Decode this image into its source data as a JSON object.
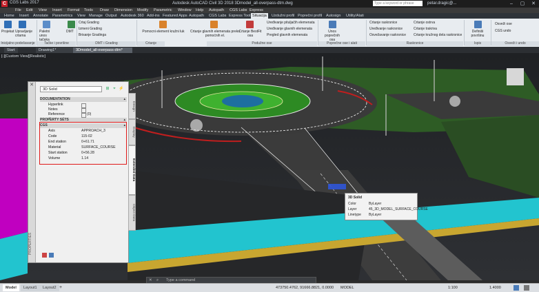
{
  "app": {
    "badge": "C",
    "quick_access": "CGS Labs 2017",
    "window_title": "Autodesk AutoCAD Civil 3D 2018   3Dmodel_all-overpass-dtm.dwg",
    "search_placeholder": "Type a keyword or phrase",
    "user": "petar.dragic@...",
    "min": "–",
    "max": "▢",
    "close": "✕"
  },
  "menu": [
    "File",
    "Edit",
    "View",
    "Insert",
    "Format",
    "Tools",
    "Draw",
    "Dimension",
    "Modify",
    "Parametric",
    "Window",
    "Help",
    "Autopath",
    "CGS Labs",
    "Express"
  ],
  "ribbon_tabs": [
    {
      "label": "Home"
    },
    {
      "label": "Insert"
    },
    {
      "label": "Annotate"
    },
    {
      "label": "Parametrics"
    },
    {
      "label": "View"
    },
    {
      "label": "Manage"
    },
    {
      "label": "Output"
    },
    {
      "label": "Autodesk 360"
    },
    {
      "label": "Add-ins"
    },
    {
      "label": "Featured Apps"
    },
    {
      "label": "Autopath"
    },
    {
      "label": "CGS Labs"
    },
    {
      "label": "Express Tools"
    },
    {
      "label": "Situacija",
      "active": true
    },
    {
      "label": "Uzdužni profil"
    },
    {
      "label": "Poprečni profil"
    },
    {
      "label": "Autosign"
    },
    {
      "label": "Utility/Alati"
    }
  ],
  "ribbon": {
    "btn1": "Projekat",
    "btn2": "Upravljanje crtama",
    "btn3": "Paletni unos tačaka",
    "btn4": "DMT",
    "btn5a": "Crtaj Grading",
    "btn5b": "Izmeni Grading",
    "btn5c": "Brisanje Gradinga",
    "btn6": "Pomocni element kružni luk",
    "btn7": "Crtanje glavnih elemenata preko pomoćnih el.",
    "btn8": "Crtanje BestFit osa",
    "btn9a": "Uređivanje pituljačih elemenata",
    "btn9b": "Uređivanje glavnih elemenata",
    "btn9c": "Pregled glavnih elemenata",
    "btn10": "Unos poprečnih osa",
    "btn11a": "Crtanje raskrsnice",
    "btn11b": "Uređivanje raskrsnice",
    "btn11c": "Osvežavanje raskrsnice",
    "btn12a": "Crtanje ostrva",
    "btn12b": "Crtanje trakriva",
    "btn12c": "Crtanje kružnog dela raskrsnice",
    "btn13": "Definiši površinu",
    "btn14a": "Osveži ose",
    "btn14b": "CGS undo",
    "p1": "Inicijalno podešavanje",
    "p2": "Tačke i površine",
    "p3": "DMT i Grading",
    "p4": "Crtanje",
    "p5": "Podužne ose",
    "p6": "Poprečne ose i alati",
    "p7": "Raskrsnice",
    "p8": "Ispis",
    "p9": "Osveži i undo"
  },
  "file_tabs": [
    {
      "label": "Start"
    },
    {
      "label": "Drawing1*"
    },
    {
      "label": "3Dmodel_all-overpass-dtm*",
      "active": true
    }
  ],
  "viewport_label": "[-][Custom View][Realistic]",
  "palette": {
    "close": "✕",
    "type_select": "3D Solid",
    "strip_title": "PROPERTIES",
    "sections": {
      "documentation": "DOCUMENTATION",
      "property_sets": "PROPERTY SETS",
      "cgs": "CGS"
    },
    "doc_rows": [
      {
        "key": "Hyperlink",
        "value": ""
      },
      {
        "key": "Notes",
        "value": ""
      },
      {
        "key": "Reference documents",
        "value": "(0)"
      }
    ],
    "cgs_rows": [
      {
        "key": "Axis",
        "value": "APPROACH_3"
      },
      {
        "key": "Code",
        "value": "115-02"
      },
      {
        "key": "End station",
        "value": "0+61.71"
      },
      {
        "key": "Material",
        "value": "SURFACE_COURSE"
      },
      {
        "key": "Start station",
        "value": "0+56.28"
      },
      {
        "key": "Volume",
        "value": "1.14"
      }
    ],
    "vtabs": [
      {
        "label": "Design"
      },
      {
        "label": "Display"
      },
      {
        "label": "Extended Data",
        "active": true
      },
      {
        "label": "Object Data"
      }
    ]
  },
  "tooltip": {
    "title": "3D Solid",
    "rows": [
      {
        "key": "Color",
        "value": "ByLayer"
      },
      {
        "key": "Layer",
        "value": "45_3D_MODEL_SURFACE_COURSE"
      },
      {
        "key": "Linetype",
        "value": "ByLayer"
      }
    ]
  },
  "command_placeholder": "Type a command",
  "status": {
    "layout_tabs": [
      {
        "label": "Model",
        "active": true
      },
      {
        "label": "Layout1"
      },
      {
        "label": "Layout2"
      }
    ],
    "coords": "473750.4762, 91666.8821, 0.0000",
    "model": "MODEL",
    "scale": "1:100",
    "scale2": "1.4000"
  },
  "colors": {
    "highlight_frame": "#e01818",
    "road": "#3c3c3c",
    "grass": "#2e7d1f",
    "cyan_band": "#22c4cf",
    "magenta": "#c000c0"
  }
}
